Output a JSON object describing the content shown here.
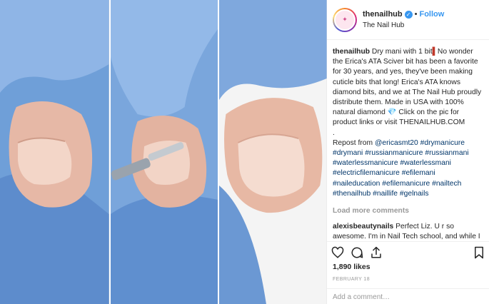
{
  "header": {
    "username": "thenailhub",
    "verified": true,
    "separator": "•",
    "follow_label": "Follow",
    "full_name": "The Nail Hub"
  },
  "caption": {
    "username": "thenailhub",
    "part1": " Dry mani with 1 bit",
    "bit_emoji": "▌",
    "part2": "No wonder the Erica's ATA Sciver bit has been a favorite for 30 years, and yes, they've been making cuticle bits that long! Erica's ATA knows diamond bits, and we at The Nail Hub proudly distribute them. Made in USA with 100% natural diamond ",
    "diamond_emoji": "💎",
    "part3": " Click on the pic for product links or visit THENAILHUB.COM",
    "dot_line": ".",
    "repost_prefix": "Repost from ",
    "repost_user": "@ericasmt20",
    "hashtags": "#drymanicure #drymani #russianmanicure #russianmani #waterlessmanicure #waterlessmani #electricfilemanicure #efilemani #naileducation #efilemanicure #nailtech #thenailhub #naillife #gelnails"
  },
  "load_more": "Load more comments",
  "comment": {
    "username": "alexisbeautynails",
    "text": " Perfect Liz. U r so awesome. I'm in Nail Tech school, and while I learn there, really, I'm just"
  },
  "likes": "1,890 likes",
  "date": "FEBRUARY 18",
  "add_comment_placeholder": "Add a comment…",
  "icons": [
    "heart-icon",
    "comment-icon",
    "share-icon",
    "bookmark-icon"
  ]
}
